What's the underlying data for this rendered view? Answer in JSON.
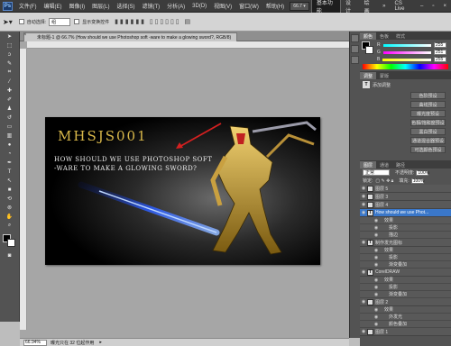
{
  "menubar": {
    "logo": "Ps",
    "items": [
      "文件(F)",
      "编辑(E)",
      "图像(I)",
      "图层(L)",
      "选择(S)",
      "滤镜(T)",
      "分析(A)",
      "3D(D)",
      "视图(V)",
      "窗口(W)",
      "帮助(H)"
    ],
    "zoom": "66.7",
    "workspaces": [
      "基本功能",
      "设计",
      "绘画"
    ],
    "cslive": "CS Live"
  },
  "options": {
    "auto_select_label": "自动选择:",
    "auto_select_value": "组",
    "show_transform_label": "显示变换控件"
  },
  "document": {
    "tab_title": "未标题-1 @ 66.7% (How should we use Photoshop soft -ware to make a glowing sword?, RGB/8)",
    "canvas_title": "MHSJS001",
    "canvas_subtitle": "HOW SHOULD WE USE PHOTOSHOP SOFT\n-WARE TO MAKE A GLOWING SWORD?"
  },
  "status": {
    "zoom": "66.94%",
    "doc_info": "曝光只在 32 位起作用"
  },
  "color_panel": {
    "tabs": [
      "颜色",
      "色板",
      "样式"
    ],
    "r_label": "R",
    "r_value": "255",
    "g_label": "G",
    "g_value": "251",
    "b_label": "B",
    "b_value": "255"
  },
  "adjust_panel": {
    "tabs": [
      "调整",
      "蒙版"
    ],
    "title": "添加调整",
    "presets": [
      "色阶预设",
      "曲线预设",
      "曝光度预设",
      "色相/饱和度预设",
      "黑白预设",
      "通道混合器预设",
      "可选颜色预设"
    ]
  },
  "layers_panel": {
    "tabs": [
      "图层",
      "通道",
      "路径"
    ],
    "blend_mode": "正常",
    "opacity_label": "不透明度:",
    "opacity_value": "100%",
    "lock_label": "锁定:",
    "fill_label": "填充:",
    "fill_value": "100%",
    "layers": [
      {
        "name": "图层 5",
        "kind": "layer"
      },
      {
        "name": "图层 3",
        "kind": "layer"
      },
      {
        "name": "图层 4",
        "kind": "layer"
      },
      {
        "name": "How should we use Phot...",
        "kind": "text",
        "selected": true
      },
      {
        "name": "效果",
        "kind": "fx-group"
      },
      {
        "name": "投影",
        "kind": "fx"
      },
      {
        "name": "描边",
        "kind": "fx"
      },
      {
        "name": "制作发光图标",
        "kind": "text"
      },
      {
        "name": "效果",
        "kind": "fx-group"
      },
      {
        "name": "投影",
        "kind": "fx"
      },
      {
        "name": "渐变叠加",
        "kind": "fx"
      },
      {
        "name": "CorelDRAW",
        "kind": "text"
      },
      {
        "name": "效果",
        "kind": "fx-group"
      },
      {
        "name": "投影",
        "kind": "fx"
      },
      {
        "name": "渐变叠加",
        "kind": "fx"
      },
      {
        "name": "图层 2",
        "kind": "layer"
      },
      {
        "name": "效果",
        "kind": "fx-group"
      },
      {
        "name": "外发光",
        "kind": "fx"
      },
      {
        "name": "颜色叠加",
        "kind": "fx"
      },
      {
        "name": "图层 1",
        "kind": "layer"
      }
    ]
  },
  "colors": {
    "accent": "#3a77c9",
    "title_gold": "#d9b84a",
    "arrow_red": "#d42020",
    "sword_blue": "#3b6cff"
  }
}
